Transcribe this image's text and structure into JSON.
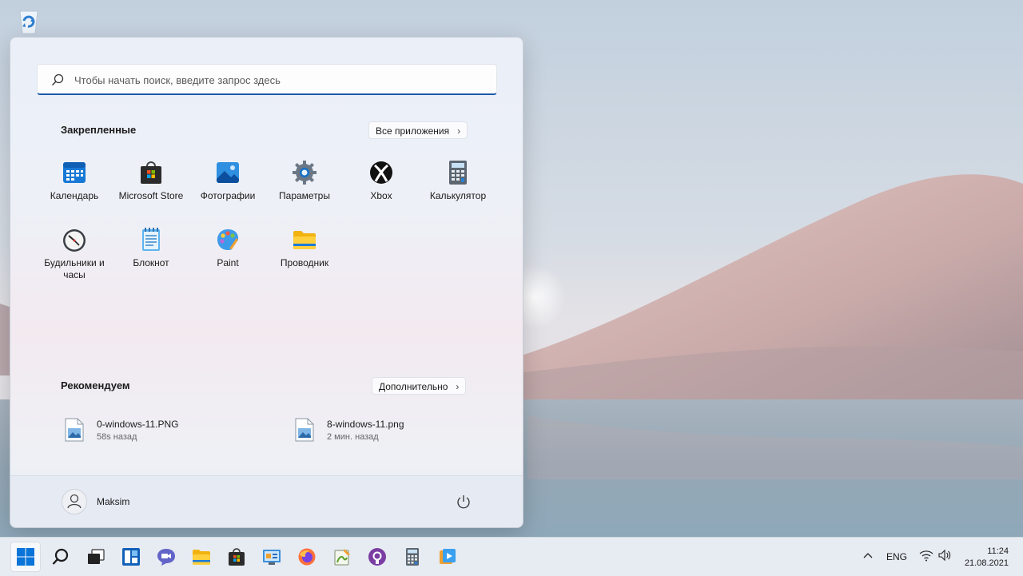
{
  "desktop": {
    "icons": [
      "recycle-bin-icon"
    ]
  },
  "start_menu": {
    "search": {
      "placeholder": "Чтобы начать поиск, введите запрос здесь"
    },
    "pinned": {
      "title": "Закрепленные",
      "all_apps_label": "Все приложения",
      "apps": [
        {
          "label": "Календарь",
          "icon": "calendar-icon"
        },
        {
          "label": "Microsoft Store",
          "icon": "store-icon"
        },
        {
          "label": "Фотографии",
          "icon": "photos-icon"
        },
        {
          "label": "Параметры",
          "icon": "settings-icon"
        },
        {
          "label": "Xbox",
          "icon": "xbox-icon"
        },
        {
          "label": "Калькулятор",
          "icon": "calculator-icon"
        },
        {
          "label": "Будильники и часы",
          "icon": "alarm-clock-icon"
        },
        {
          "label": "Блокнот",
          "icon": "notepad-icon"
        },
        {
          "label": "Paint",
          "icon": "paint-icon"
        },
        {
          "label": "Проводник",
          "icon": "folder-icon"
        }
      ]
    },
    "recommended": {
      "title": "Рекомендуем",
      "more_label": "Дополнительно",
      "items": [
        {
          "name": "0-windows-11.PNG",
          "time": "58s назад",
          "icon": "image-file-icon"
        },
        {
          "name": "8-windows-11.png",
          "time": "2 мин. назад",
          "icon": "image-file-icon"
        }
      ]
    },
    "user": {
      "name": "Maksim"
    }
  },
  "taskbar": {
    "apps": [
      "start-icon",
      "search-icon",
      "task-view-icon",
      "widgets-icon",
      "chat-icon",
      "file-explorer-icon",
      "store-icon",
      "control-panel-icon",
      "firefox-icon",
      "notepad-plus-icon",
      "github-icon",
      "calculator-icon",
      "media-player-icon"
    ],
    "tray": {
      "language": "ENG",
      "time": "11:24",
      "date": "21.08.2021"
    }
  },
  "colors": {
    "accent": "#1a5aa6",
    "start_blue": "#0a74d8"
  }
}
